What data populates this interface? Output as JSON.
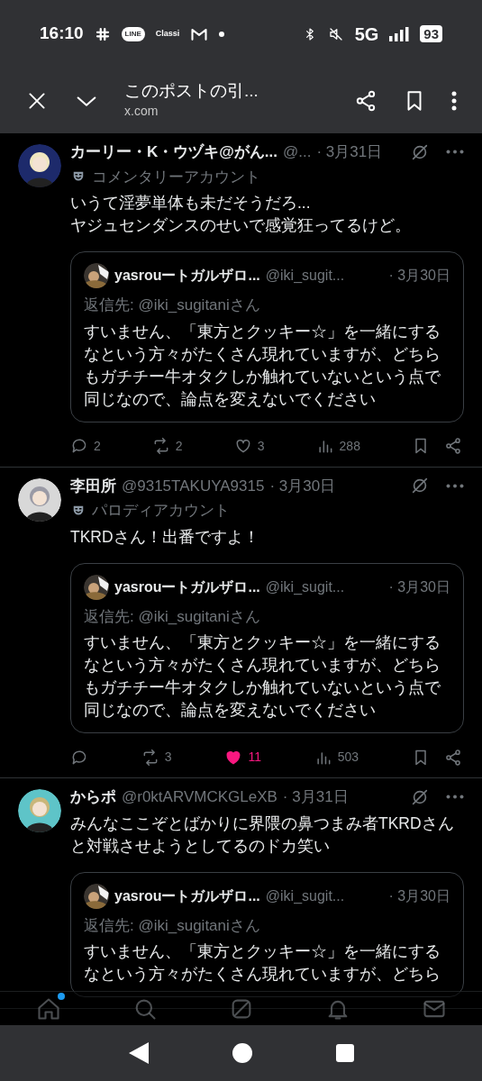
{
  "status_bar": {
    "time": "16:10",
    "app_labels": [
      "LINE",
      "Classi"
    ],
    "network": "5G",
    "battery": "93"
  },
  "browser_bar": {
    "title": "このポストの引...",
    "url": "x.com"
  },
  "posts": [
    {
      "name": "カーリー・K・ウヅキ@がん...",
      "handle": "@...",
      "date": "· 3月31日",
      "account_label": "コメンタリーアカウント",
      "text": "いうて淫夢単体も未だそうだろ...\nヤジュセンダンスのせいで感覚狂ってるけど。",
      "quote": {
        "name": "yasrouートガルザロ...",
        "handle": "@iki_sugit...",
        "date": "· 3月30日",
        "reply_to": "返信先: @iki_sugitaniさん",
        "text": "すいません、「東方とクッキー☆」を一緒にするなという方々がたくさん現れていますが、どちらもガチチー牛オタクしか触れていないという点で同じなので、論点を変えないでください"
      },
      "actions": {
        "replies": "2",
        "reposts": "2",
        "likes": "3",
        "liked": false,
        "views": "288"
      }
    },
    {
      "name": "李田所",
      "handle": "@9315TAKUYA9315",
      "date": "· 3月30日",
      "account_label": "パロディアカウント",
      "text": "TKRDさん！出番ですよ！",
      "quote": {
        "name": "yasrouートガルザロ...",
        "handle": "@iki_sugit...",
        "date": "· 3月30日",
        "reply_to": "返信先: @iki_sugitaniさん",
        "text": "すいません、「東方とクッキー☆」を一緒にするなという方々がたくさん現れていますが、どちらもガチチー牛オタクしか触れていないという点で同じなので、論点を変えないでください"
      },
      "actions": {
        "reposts": "3",
        "likes": "11",
        "liked": true,
        "views": "503"
      }
    },
    {
      "name": "からポ",
      "handle": "@r0ktARVMCKGLeXB",
      "date": "· 3月31日",
      "text": "みんなここぞとばかりに界隈の鼻つまみ者TKRDさんと対戦させようとしてるのドカ笑い",
      "quote": {
        "name": "yasrouートガルザロ...",
        "handle": "@iki_sugit...",
        "date": "· 3月30日",
        "reply_to": "返信先: @iki_sugitaniさん",
        "text": "すいません、「東方とクッキー☆」を一緒にするなという方々がたくさん現れていますが、どちら"
      }
    }
  ],
  "bottom_nav": {
    "items": [
      {
        "kind": "home",
        "dot": true
      },
      {
        "kind": "search",
        "dot": false
      },
      {
        "kind": "grok",
        "dot": false
      },
      {
        "kind": "bell",
        "dot": false
      },
      {
        "kind": "mail",
        "dot": false
      }
    ]
  }
}
